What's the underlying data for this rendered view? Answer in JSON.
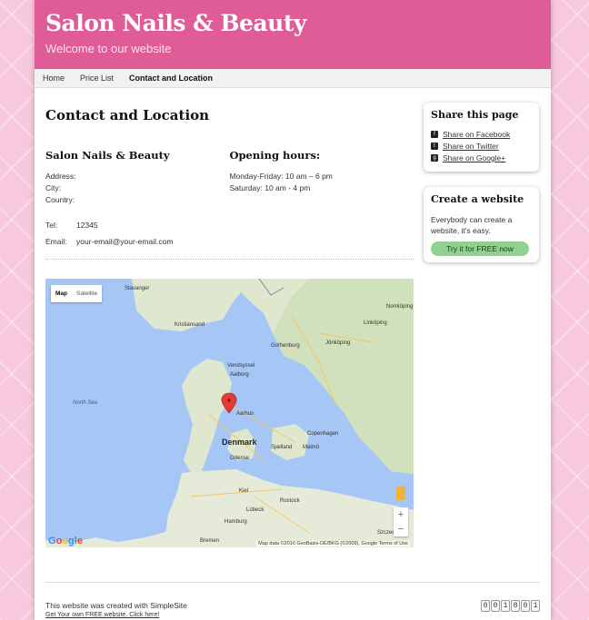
{
  "header": {
    "title": "Salon Nails & Beauty",
    "subtitle": "Welcome to our website"
  },
  "nav": {
    "items": [
      "Home",
      "Price List",
      "Contact and Location"
    ],
    "active": "Contact and Location"
  },
  "main": {
    "page_title": "Contact and Location",
    "business": {
      "name": "Salon Nails & Beauty",
      "address_label": "Address:",
      "city_label": "City:",
      "country_label": "Country:",
      "tel_label": "Tel:",
      "tel_value": "12345",
      "email_label": "Email:",
      "email_value": "your-email@your-email.com"
    },
    "hours": {
      "title": "Opening hours:",
      "lines": [
        "Monday-Friday: 10 am – 6 pm",
        "Saturday: 10 am - 4 pm"
      ]
    }
  },
  "map": {
    "toggle_map": "Map",
    "toggle_satellite": "Satellite",
    "labels": {
      "stavanger": "Stavanger",
      "kristiansand": "Kristiansand",
      "norrkoping": "Norrköping",
      "linkoping": "Linköping",
      "gothenburg": "Gothenburg",
      "jonkoping": "Jönköping",
      "vendsyssel": "Vendsyssel",
      "aalborg": "Aalborg",
      "north_sea": "North Sea",
      "aarhus": "Aarhus",
      "denmark": "Denmark",
      "copenhagen": "Copenhagen",
      "sjaelland": "Sjælland",
      "malmo": "Malmö",
      "odense": "Odense",
      "kiel": "Kiel",
      "rostock": "Rostock",
      "lubeck": "Lübeck",
      "hamburg": "Hamburg",
      "szczecin": "Szczecin",
      "bremen": "Bremen"
    },
    "zoom_in": "+",
    "zoom_out": "−",
    "google": "Google",
    "attribution": "Map data ©2016 GeoBasis-DE/BKG (©2009), Google    Terms of Use"
  },
  "sidebar": {
    "share_title": "Share this page",
    "shares": [
      {
        "icon": "facebook-icon",
        "label": "Share on Facebook"
      },
      {
        "icon": "twitter-icon",
        "label": "Share on Twitter"
      },
      {
        "icon": "googleplus-icon",
        "label": "Share on Google+"
      }
    ],
    "create_title": "Create a website",
    "create_text": "Everybody can create a website, it's easy.",
    "create_button": "Try it for FREE now"
  },
  "footer": {
    "created": "This website was created with SimpleSite",
    "link": "Get Your own FREE website. Click here!",
    "counter": [
      "0",
      "0",
      "1",
      "8",
      "0",
      "1"
    ]
  },
  "colors": {
    "header": "#df5c96",
    "background": "#f8c8dc",
    "button": "#8fd28f",
    "map_water": "#a6c6f6",
    "map_land": "#dfe8cf",
    "pin": "#e53935"
  }
}
